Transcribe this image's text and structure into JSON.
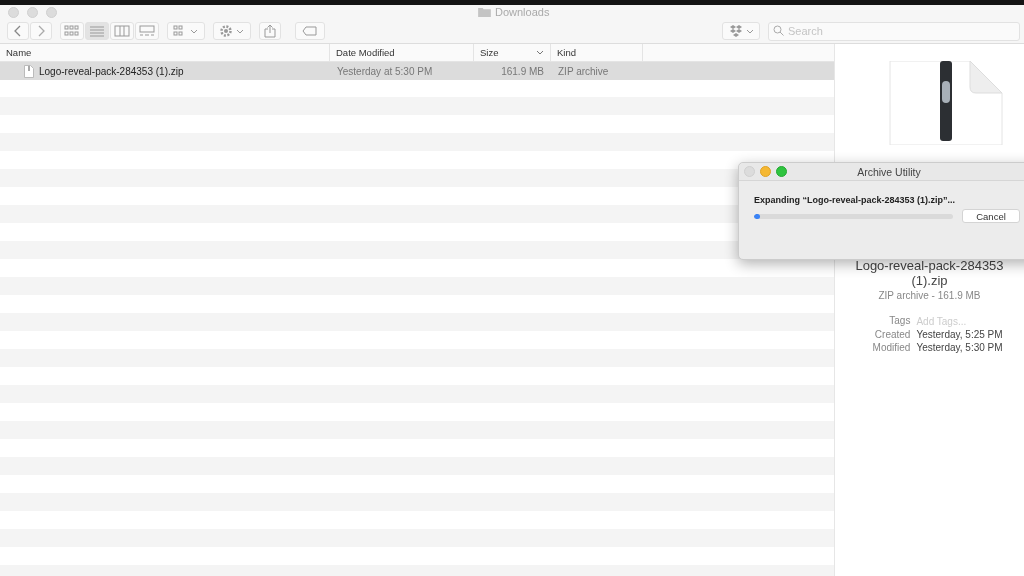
{
  "window": {
    "title": "Downloads"
  },
  "toolbar": {
    "view_modes": [
      {
        "selected": false
      },
      {
        "selected": true
      },
      {
        "selected": false
      },
      {
        "selected": false
      }
    ],
    "search": {
      "placeholder": "Search"
    }
  },
  "table": {
    "columns": [
      {
        "label": "Name",
        "sorted": false
      },
      {
        "label": "Date Modified",
        "sorted": false
      },
      {
        "label": "Size",
        "sorted": true
      },
      {
        "label": "Kind",
        "sorted": false
      }
    ],
    "rows": [
      {
        "name": "Logo-reveal-pack-284353 (1).zip",
        "date_modified": "Yesterday at 5:30 PM",
        "size": "161.9 MB",
        "kind": "ZIP archive",
        "selected": true
      }
    ]
  },
  "preview": {
    "name": "Logo-reveal-pack-284353 (1).zip",
    "summary": "ZIP archive - 161.9 MB",
    "tags": {
      "label": "Tags",
      "placeholder": "Add Tags..."
    },
    "fields": [
      {
        "label": "Created",
        "value": "Yesterday, 5:25 PM"
      },
      {
        "label": "Modified",
        "value": "Yesterday, 5:30 PM"
      }
    ]
  },
  "dialog": {
    "title": "Archive Utility",
    "message": "Expanding “Logo-reveal-pack-284353 (1).zip”...",
    "level": 0.03,
    "button": "Cancel"
  }
}
